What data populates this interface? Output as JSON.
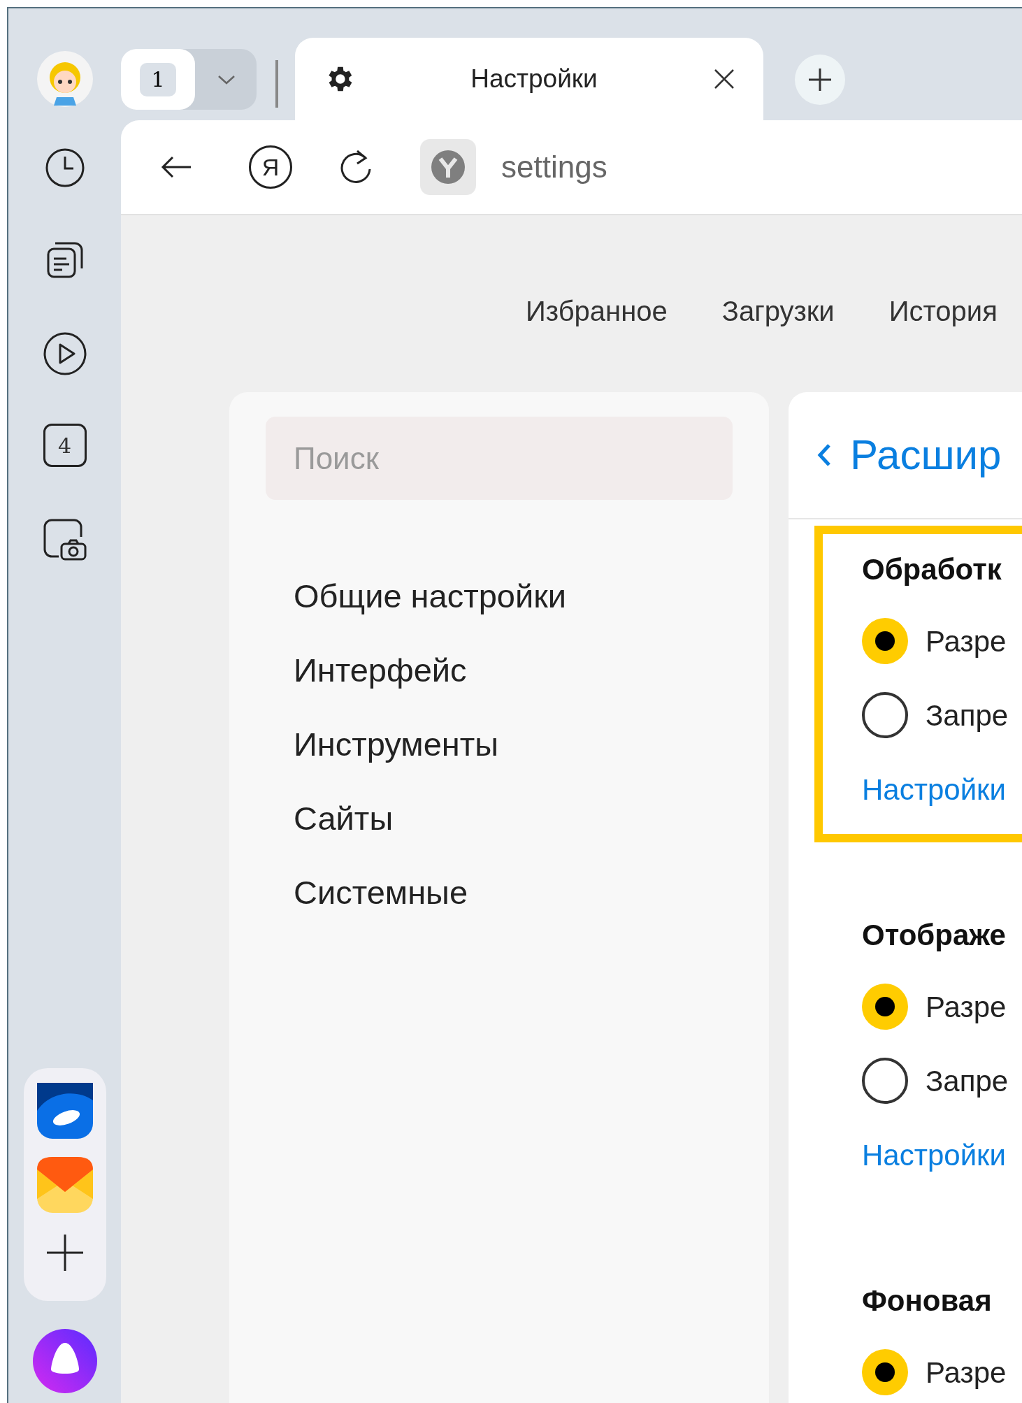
{
  "tab_counter": "1",
  "tab": {
    "title": "Настройки"
  },
  "address": {
    "home_logo": "Я",
    "url": "settings"
  },
  "side_badge": "4",
  "nav_links": [
    "Избранное",
    "Загрузки",
    "История"
  ],
  "search": {
    "placeholder": "Поиск"
  },
  "menu": [
    {
      "label": "Общие настройки"
    },
    {
      "label": "Интерфейс"
    },
    {
      "label": "Инструменты"
    },
    {
      "label": "Сайты"
    },
    {
      "label": "Системные"
    }
  ],
  "content": {
    "title": "Расшир",
    "sections": [
      {
        "heading": "Обработк",
        "highlighted": true,
        "options": [
          {
            "label": "Разре",
            "selected": true
          },
          {
            "label": "Запре",
            "selected": false
          }
        ],
        "link": "Настройки"
      },
      {
        "heading": "Отображе",
        "highlighted": false,
        "options": [
          {
            "label": "Разре",
            "selected": true
          },
          {
            "label": "Запре",
            "selected": false
          }
        ],
        "link": "Настройки"
      },
      {
        "heading": "Фоновая",
        "highlighted": false,
        "options": [
          {
            "label": "Разре",
            "selected": true
          }
        ]
      }
    ]
  }
}
